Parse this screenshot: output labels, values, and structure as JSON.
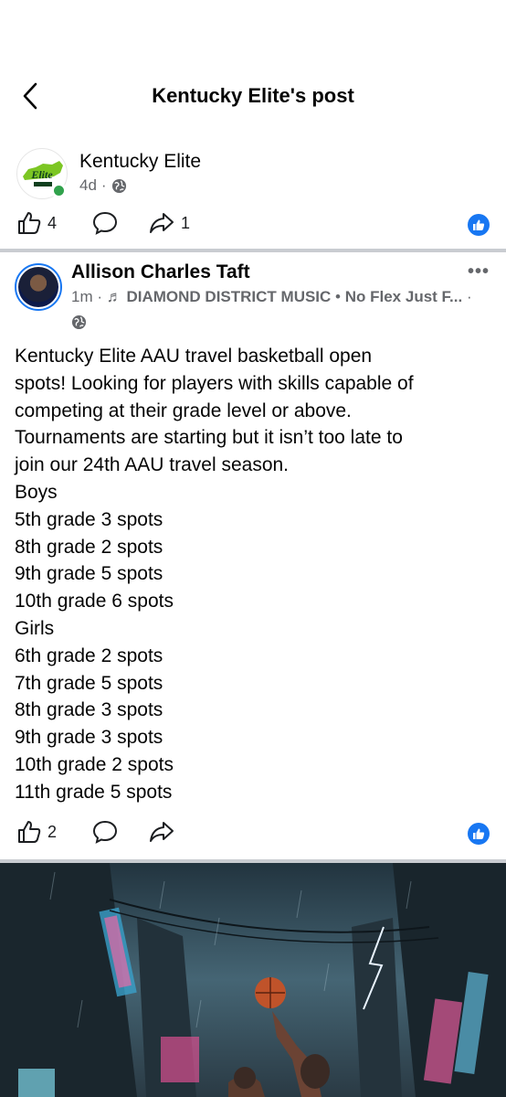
{
  "header": {
    "title": "Kentucky Elite's post"
  },
  "page_post": {
    "author": "Kentucky Elite",
    "avatar_logo_text": "Elite",
    "time": "4d",
    "likes": "4",
    "shares": "1"
  },
  "shared_post": {
    "author": "Allison Charles Taft",
    "time": "1m",
    "music_label": "DIAMOND DISTRICT MUSIC",
    "song": "No Flex Just F...",
    "body_lines": [
      "Kentucky Elite AAU travel basketball open",
      "spots! Looking for players with skills capable of",
      "competing at their grade level or above.",
      "Tournaments are starting but it isn’t too late to",
      "join our 24th AAU travel season.",
      "Boys",
      "5th grade 3 spots",
      "8th grade 2 spots",
      "9th grade 5 spots",
      "10th grade 6 spots",
      "Girls",
      "6th grade 2 spots",
      "7th grade 5 spots",
      "8th grade 3 spots",
      "9th grade 3 spots",
      "10th grade 2 spots",
      "11th grade 5 spots"
    ],
    "likes": "2"
  },
  "colors": {
    "brand_blue": "#1877f2",
    "online_green": "#31a24c",
    "secondary_text": "#65676b"
  },
  "icons": [
    "back-chevron-icon",
    "globe-icon",
    "thumbs-up-icon",
    "comment-icon",
    "share-icon",
    "like-reaction-icon",
    "more-options-icon",
    "music-note-icon"
  ]
}
